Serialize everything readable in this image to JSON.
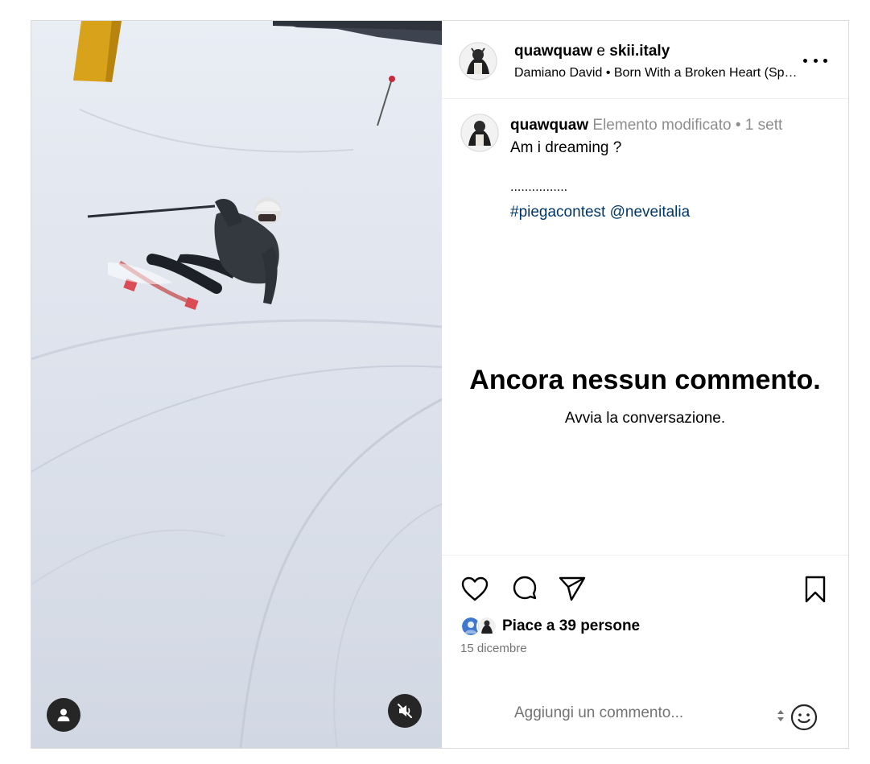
{
  "post": {
    "header": {
      "author": "quawquaw",
      "connector": "e",
      "collaborator": "skii.italy",
      "audio": "Damiano David • Born With a Broken Heart (Sped Up)"
    },
    "caption": {
      "username": "quawquaw",
      "edited_label": "Elemento modificato",
      "separator": "•",
      "time_ago": "1 sett",
      "text": "Am i dreaming ?",
      "dots": "................",
      "hashtag": "#piegacontest",
      "mention": "@neveitalia"
    },
    "empty_comments": {
      "title": "Ancora nessun commento.",
      "subtitle": "Avvia la conversazione."
    },
    "likes": {
      "prefix": "Piace a",
      "count": "39",
      "suffix": "persone"
    },
    "date": "15 dicembre",
    "comment_input": {
      "placeholder": "Aggiungi un commento..."
    },
    "icons": {
      "more": "more-horizontal-icon",
      "like": "heart-icon",
      "comment": "comment-bubble-icon",
      "share": "paper-plane-icon",
      "save": "bookmark-icon",
      "emoji": "smiley-icon",
      "user_tag": "user-icon",
      "mute": "speaker-muted-icon"
    },
    "colors": {
      "link": "#00376b",
      "muted_text": "#8e8e8e",
      "border": "#dbdbdb"
    }
  }
}
